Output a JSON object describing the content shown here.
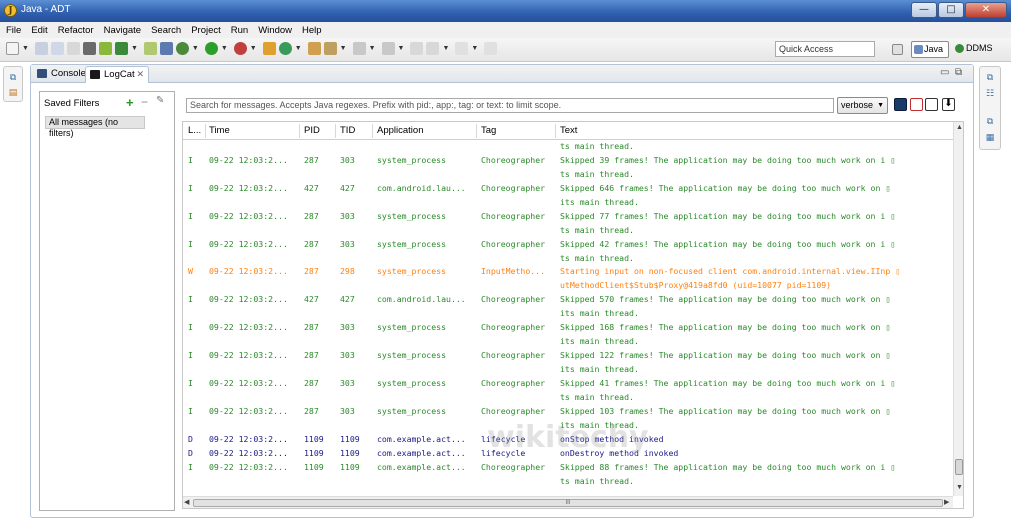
{
  "window": {
    "title": "Java - ADT",
    "app_icon_letter": "J"
  },
  "window_controls": {
    "minimize": "—",
    "maximize": "□",
    "close": "✕"
  },
  "menu": [
    "File",
    "Edit",
    "Refactor",
    "Navigate",
    "Search",
    "Project",
    "Run",
    "Window",
    "Help"
  ],
  "toolbar": {
    "quick_access": "Quick Access",
    "perspectives": {
      "java": "Java",
      "ddms": "DDMS"
    }
  },
  "tabs": {
    "console": "Console",
    "logcat": "LogCat",
    "close_glyph": "✕"
  },
  "view_controls": {
    "minimize": "▭",
    "maximize": "⧉"
  },
  "saved_filters": {
    "title": "Saved Filters",
    "add": "+",
    "remove": "−",
    "edit": "✎",
    "items": [
      "All messages (no filters)"
    ]
  },
  "search": {
    "placeholder": "Search for messages. Accepts Java regexes. Prefix with pid:, app:, tag: or text: to limit scope."
  },
  "log_level": {
    "selected": "verbose"
  },
  "columns": {
    "level": "L...",
    "time": "Time",
    "pid": "PID",
    "tid": "TID",
    "application": "Application",
    "tag": "Tag",
    "text": "Text"
  },
  "log_rows": [
    {
      "level": "",
      "time": "",
      "pid": "",
      "tid": "",
      "app": "",
      "tag": "",
      "text": "ts main thread."
    },
    {
      "level": "I",
      "time": "09-22 12:03:2...",
      "pid": "287",
      "tid": "303",
      "app": "system_process",
      "tag": "Choreographer",
      "text": "Skipped 39 frames!  The application may be doing too much work on i ▯"
    },
    {
      "level": "",
      "time": "",
      "pid": "",
      "tid": "",
      "app": "",
      "tag": "",
      "text": "ts main thread."
    },
    {
      "level": "I",
      "time": "09-22 12:03:2...",
      "pid": "427",
      "tid": "427",
      "app": "com.android.lau...",
      "tag": "Choreographer",
      "text": "Skipped 646 frames!  The application may be doing too much work on  ▯"
    },
    {
      "level": "",
      "time": "",
      "pid": "",
      "tid": "",
      "app": "",
      "tag": "",
      "text": "its main thread."
    },
    {
      "level": "I",
      "time": "09-22 12:03:2...",
      "pid": "287",
      "tid": "303",
      "app": "system_process",
      "tag": "Choreographer",
      "text": "Skipped 77 frames!  The application may be doing too much work on i ▯"
    },
    {
      "level": "",
      "time": "",
      "pid": "",
      "tid": "",
      "app": "",
      "tag": "",
      "text": "ts main thread."
    },
    {
      "level": "I",
      "time": "09-22 12:03:2...",
      "pid": "287",
      "tid": "303",
      "app": "system_process",
      "tag": "Choreographer",
      "text": "Skipped 42 frames!  The application may be doing too much work on i ▯"
    },
    {
      "level": "",
      "time": "",
      "pid": "",
      "tid": "",
      "app": "",
      "tag": "",
      "text": "ts main thread."
    },
    {
      "level": "W",
      "time": "09-22 12:03:2...",
      "pid": "287",
      "tid": "298",
      "app": "system_process",
      "tag": "InputMetho...",
      "text": "Starting input on non-focused client com.android.internal.view.IInp ▯"
    },
    {
      "level": "",
      "time": "",
      "pid": "",
      "tid": "",
      "app": "",
      "tag": "",
      "text": "utMethodClient$Stub$Proxy@419a8fd0 (uid=10077 pid=1109)",
      "lvl_color": "W"
    },
    {
      "level": "I",
      "time": "09-22 12:03:2...",
      "pid": "427",
      "tid": "427",
      "app": "com.android.lau...",
      "tag": "Choreographer",
      "text": "Skipped 570 frames!  The application may be doing too much work on  ▯"
    },
    {
      "level": "",
      "time": "",
      "pid": "",
      "tid": "",
      "app": "",
      "tag": "",
      "text": "its main thread."
    },
    {
      "level": "I",
      "time": "09-22 12:03:2...",
      "pid": "287",
      "tid": "303",
      "app": "system_process",
      "tag": "Choreographer",
      "text": "Skipped 168 frames!  The application may be doing too much work on  ▯"
    },
    {
      "level": "",
      "time": "",
      "pid": "",
      "tid": "",
      "app": "",
      "tag": "",
      "text": "its main thread."
    },
    {
      "level": "I",
      "time": "09-22 12:03:2...",
      "pid": "287",
      "tid": "303",
      "app": "system_process",
      "tag": "Choreographer",
      "text": "Skipped 122 frames!  The application may be doing too much work on  ▯"
    },
    {
      "level": "",
      "time": "",
      "pid": "",
      "tid": "",
      "app": "",
      "tag": "",
      "text": "its main thread."
    },
    {
      "level": "I",
      "time": "09-22 12:03:2...",
      "pid": "287",
      "tid": "303",
      "app": "system_process",
      "tag": "Choreographer",
      "text": "Skipped 41 frames!  The application may be doing too much work on i ▯"
    },
    {
      "level": "",
      "time": "",
      "pid": "",
      "tid": "",
      "app": "",
      "tag": "",
      "text": "ts main thread."
    },
    {
      "level": "I",
      "time": "09-22 12:03:2...",
      "pid": "287",
      "tid": "303",
      "app": "system_process",
      "tag": "Choreographer",
      "text": "Skipped 103 frames!  The application may be doing too much work on  ▯"
    },
    {
      "level": "",
      "time": "",
      "pid": "",
      "tid": "",
      "app": "",
      "tag": "",
      "text": "its main thread."
    },
    {
      "level": "D",
      "time": "09-22 12:03:2...",
      "pid": "1109",
      "tid": "1109",
      "app": "com.example.act...",
      "tag": "lifecycle",
      "text": "onStop method invoked"
    },
    {
      "level": "D",
      "time": "09-22 12:03:2...",
      "pid": "1109",
      "tid": "1109",
      "app": "com.example.act...",
      "tag": "lifecycle",
      "text": "onDestroy method invoked"
    },
    {
      "level": "I",
      "time": "09-22 12:03:2...",
      "pid": "1109",
      "tid": "1109",
      "app": "com.example.act...",
      "tag": "Choreographer",
      "text": "Skipped 88 frames!  The application may be doing too much work on i ▯"
    },
    {
      "level": "",
      "time": "",
      "pid": "",
      "tid": "",
      "app": "",
      "tag": "",
      "text": "ts main thread."
    }
  ],
  "scroll": {
    "up": "▲",
    "down": "▼",
    "left": "◀",
    "right": "▶",
    "hgrip": "III"
  },
  "watermark": "wikitechy",
  "colors": {
    "info": "#2a8a2a",
    "warn": "#ff8010",
    "debug": "#1a1a8a",
    "titlebar": "#2f5fae"
  }
}
